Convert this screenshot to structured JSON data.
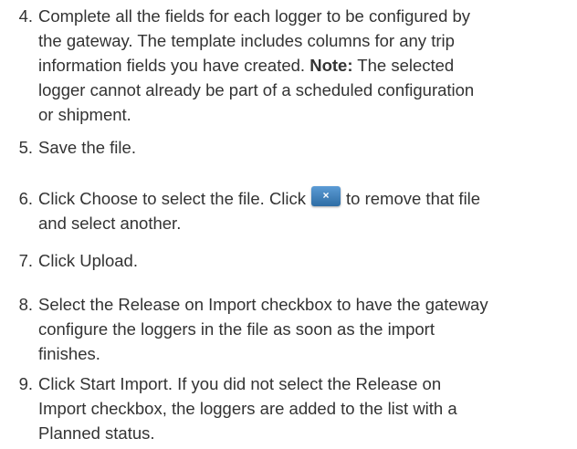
{
  "steps": [
    {
      "number": "4",
      "lines": [
        "Complete all the fields for each logger to be configured by",
        "the gateway. The template includes columns for any trip",
        "information fields you have created.",
        "logger cannot already be part of a scheduled configuration",
        "or shipment."
      ],
      "note_label": "Note:",
      "note_after": "The selected"
    },
    {
      "number": "5",
      "lines": [
        "Save the file."
      ]
    },
    {
      "number": "6",
      "lines_before": "Click Choose to select the file. Click",
      "lines_after": "to remove that file",
      "lines": [
        "and select another."
      ],
      "button_glyph": "×"
    },
    {
      "number": "7",
      "lines": [
        "Click Upload."
      ]
    },
    {
      "number": "8",
      "lines": [
        "Select the Release on Import checkbox to have the gateway",
        "configure the loggers in the file as soon as the import",
        "finishes."
      ]
    },
    {
      "number": "9",
      "lines": [
        "Click Start Import. If you did not select the Release on",
        "Import checkbox, the loggers are added to the list with a",
        "Planned status."
      ]
    }
  ]
}
